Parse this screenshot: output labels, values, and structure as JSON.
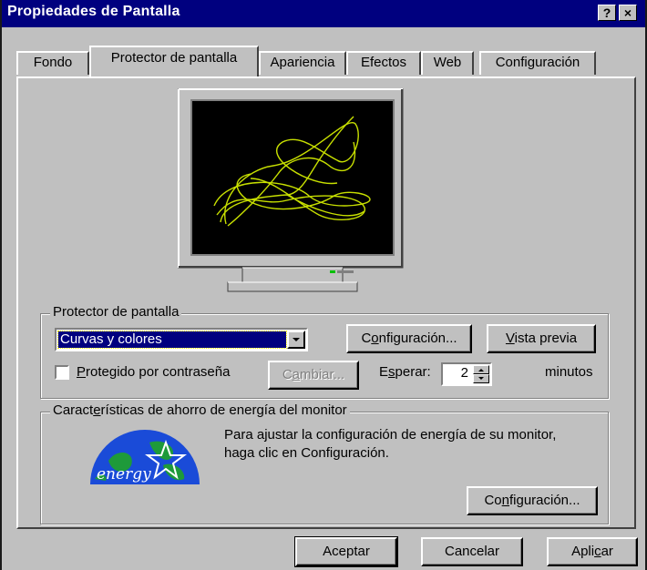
{
  "window": {
    "title": "Propiedades de Pantalla",
    "help_button": "?",
    "close_button": "×"
  },
  "tabs": [
    {
      "label": "Fondo",
      "active": false
    },
    {
      "label": "Protector de pantalla",
      "active": true
    },
    {
      "label": "Apariencia",
      "active": false
    },
    {
      "label": "Efectos",
      "active": false
    },
    {
      "label": "Web",
      "active": false
    },
    {
      "label": "Configuración",
      "active": false
    }
  ],
  "preview": {
    "screen_color": "#000000",
    "curve_color": "#c8e000"
  },
  "screensaver_group": {
    "legend": "Protector de pantalla",
    "selected": "Curvas y colores",
    "settings_button": {
      "pre": "C",
      "u": "o",
      "post": "nfiguración..."
    },
    "preview_button": {
      "pre": "",
      "u": "V",
      "post": "ista previa"
    },
    "password_checkbox": {
      "checked": false,
      "pre": "",
      "u": "P",
      "post": "rotegido por contraseña"
    },
    "change_button": {
      "pre": "C",
      "u": "a",
      "post": "mbiar..."
    },
    "wait_label": {
      "pre": "E",
      "u": "s",
      "post": "perar:"
    },
    "wait_value": "2",
    "minutes_label": "minutos"
  },
  "energy_group": {
    "legend": {
      "pre": "Caract",
      "u": "e",
      "post": "rísticas de ahorro de energía del monitor"
    },
    "description": "Para ajustar la configuración de energía de su monitor, haga clic en Configuración.",
    "settings_button": {
      "pre": "Co",
      "u": "n",
      "post": "figuración..."
    },
    "logo_text": "energy"
  },
  "footer": {
    "ok": "Aceptar",
    "cancel": "Cancelar",
    "apply": {
      "pre": "Apli",
      "u": "c",
      "post": "ar"
    }
  }
}
